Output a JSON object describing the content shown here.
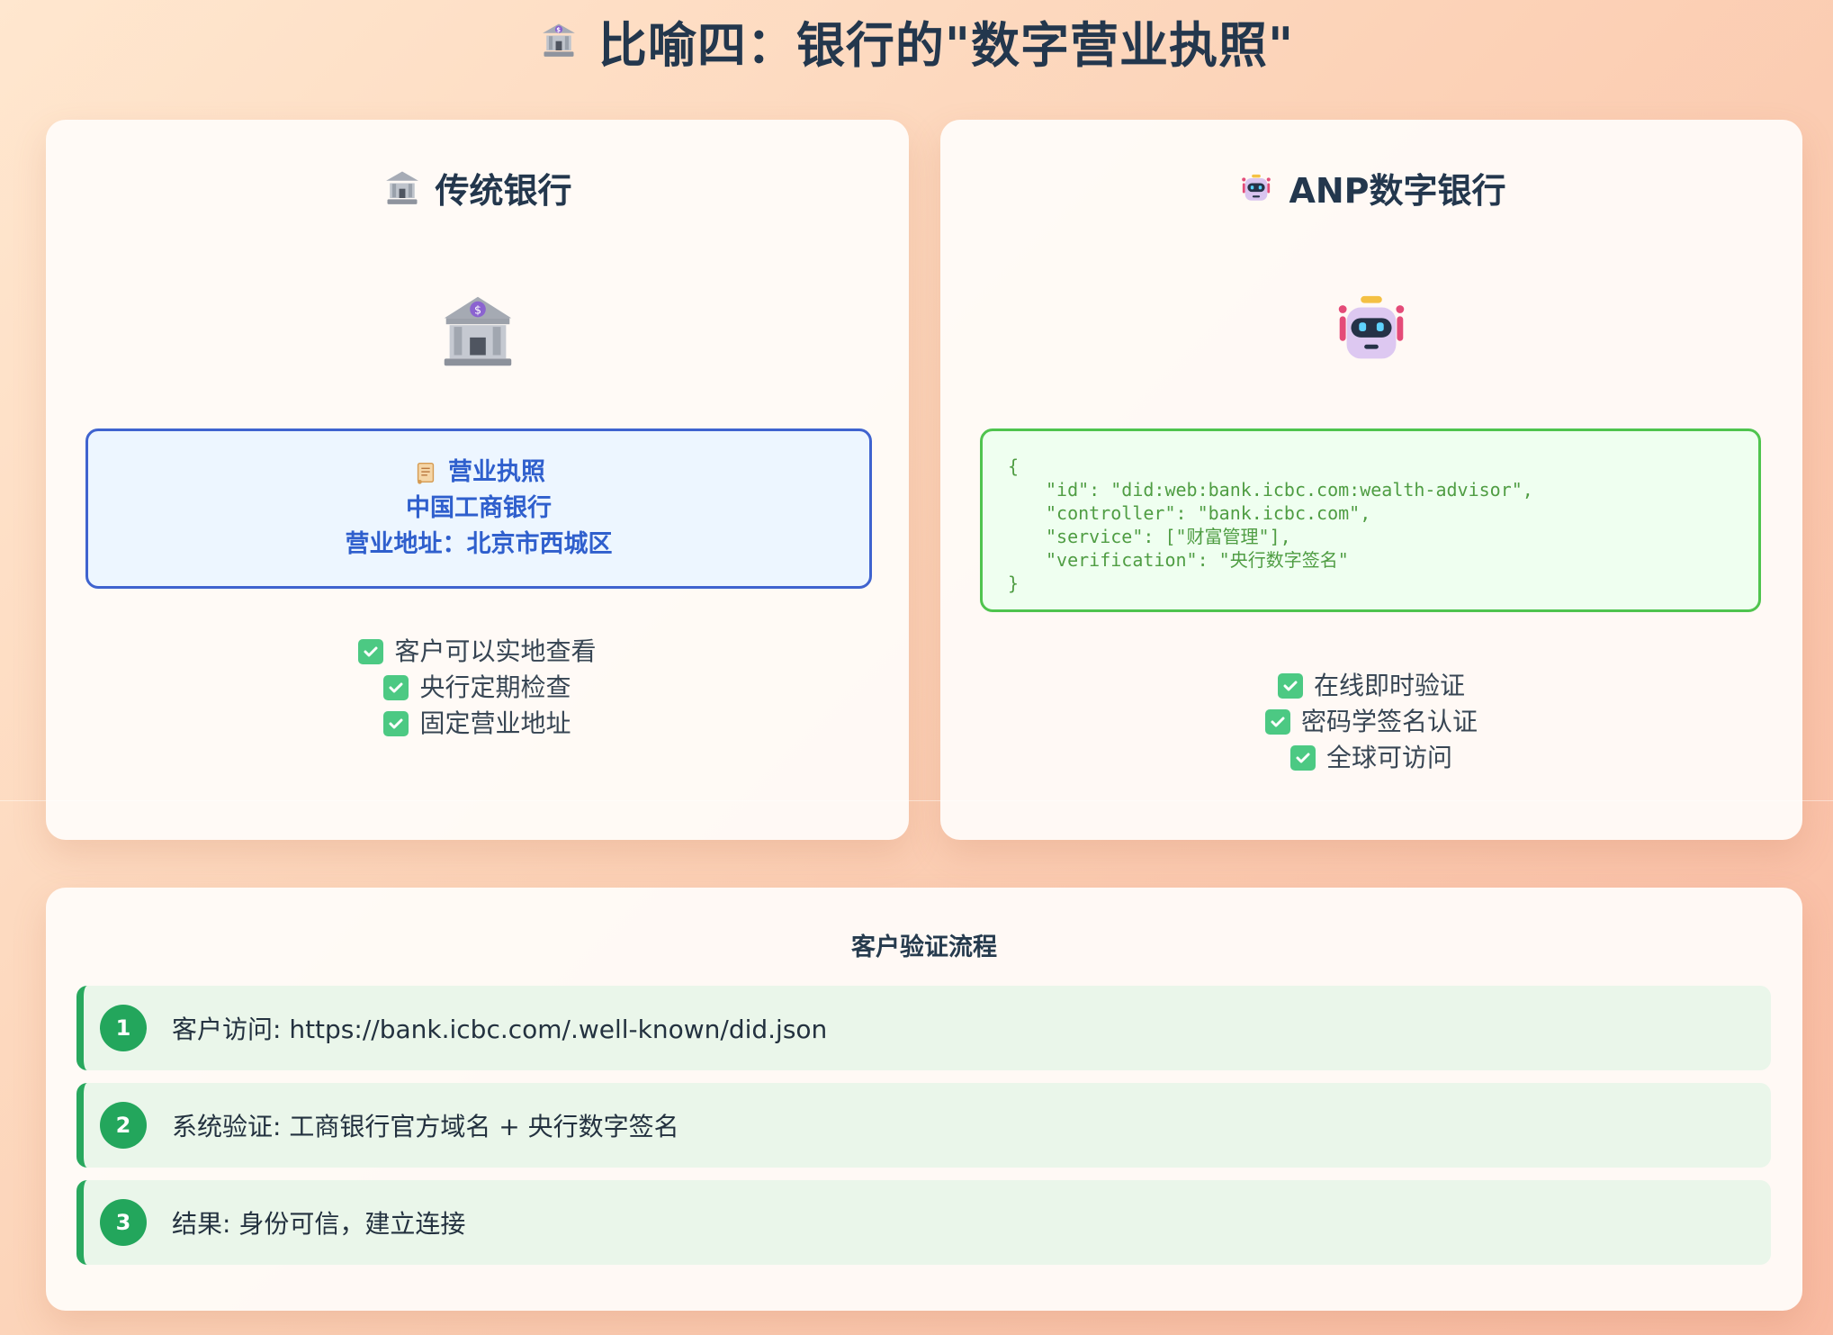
{
  "title": {
    "icon": "bank-icon",
    "text": "比喻四：银行的\"数字营业执照\""
  },
  "traditional": {
    "heading": "传统银行",
    "icon": "bank-icon",
    "license": {
      "icon": "scroll-icon",
      "title": "营业执照",
      "name": "中国工商银行",
      "address": "营业地址：北京市西城区"
    },
    "checks": [
      "客户可以实地查看",
      "央行定期检查",
      "固定营业地址"
    ]
  },
  "anp": {
    "heading": "ANP数字银行",
    "icon": "robot-icon",
    "did_json": {
      "open": "{",
      "id_line": "\"id\": \"did:web:bank.icbc.com:wealth-advisor\",",
      "controller_line": "\"controller\": \"bank.icbc.com\",",
      "service_line": "\"service\": [\"财富管理\"],",
      "verification_line": "\"verification\": \"央行数字签名\"",
      "close": "}"
    },
    "checks": [
      "在线即时验证",
      "密码学签名认证",
      "全球可访问"
    ]
  },
  "flow": {
    "title": "客户验证流程",
    "steps": [
      {
        "num": "1",
        "text": "客户访问: https://bank.icbc.com/.well-known/did.json"
      },
      {
        "num": "2",
        "text": "系统验证: 工商银行官方域名 + 央行数字签名"
      },
      {
        "num": "3",
        "text": "结果: 身份可信，建立连接"
      }
    ]
  },
  "colors": {
    "accent_blue": "#3f63cf",
    "accent_green": "#28a85e",
    "check_green": "#4cc983"
  }
}
